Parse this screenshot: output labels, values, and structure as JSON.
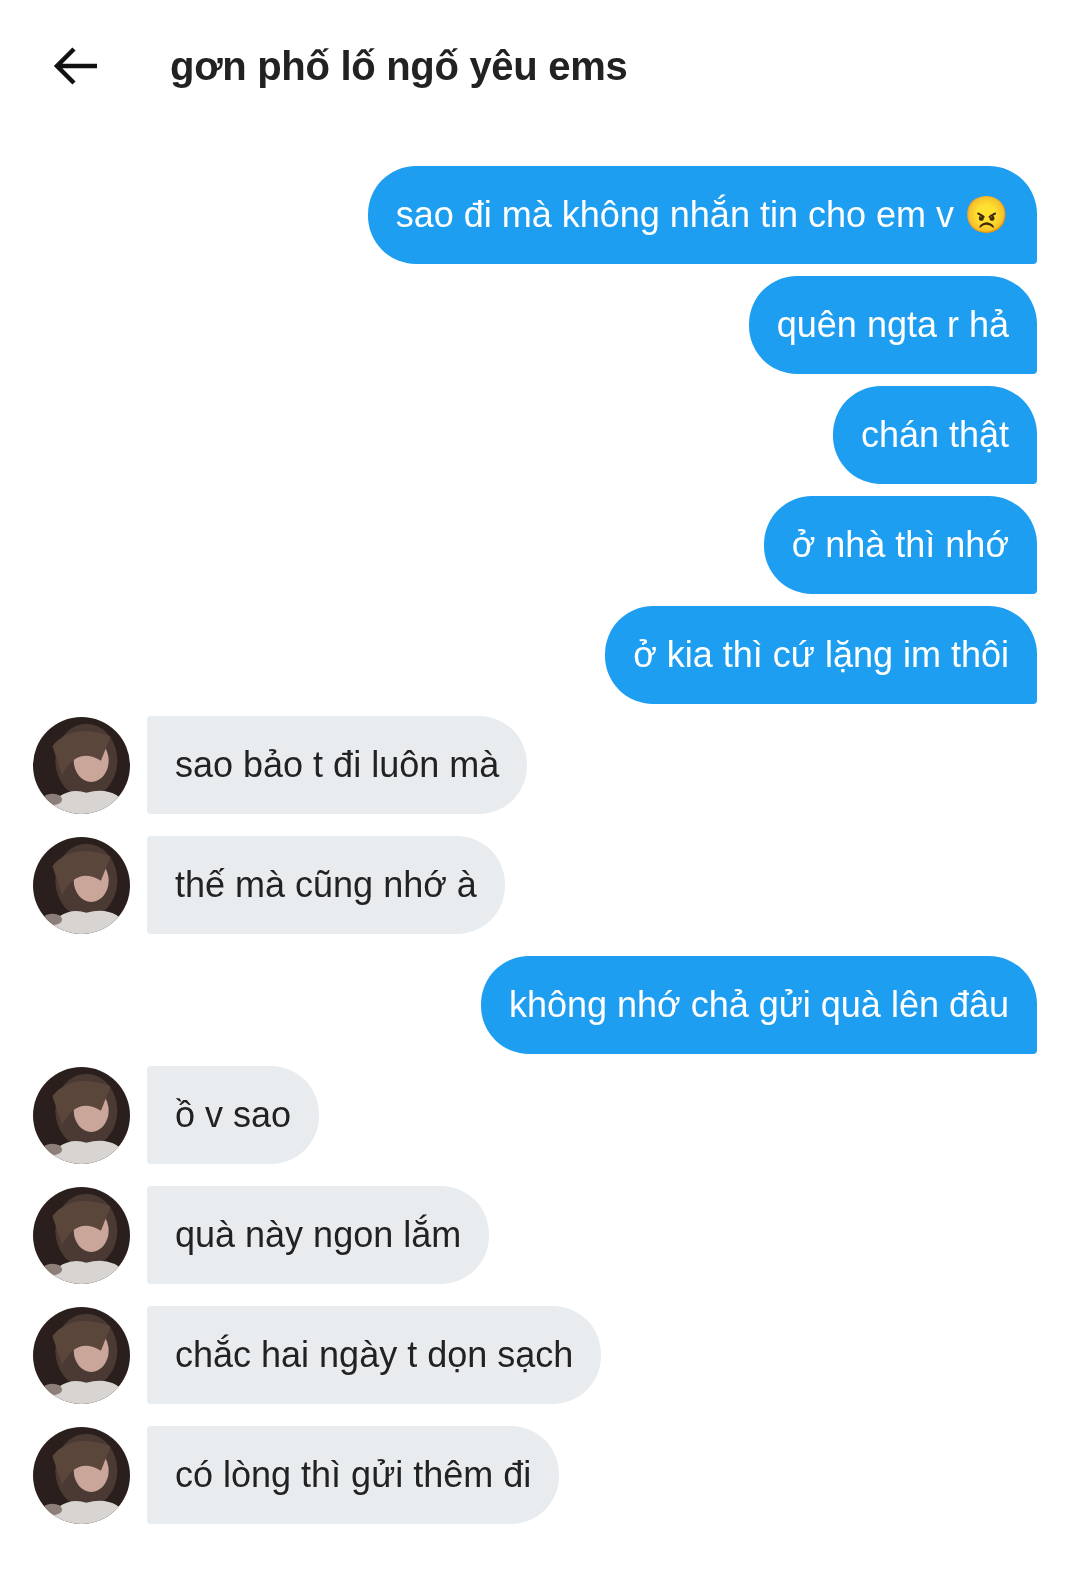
{
  "header": {
    "title": "gơn phố lố ngố yêu ems"
  },
  "messages": [
    {
      "kind": "sent",
      "text": "sao đi mà không nhắn tin cho em v 😠"
    },
    {
      "kind": "sent",
      "text": "quên ngta r hả"
    },
    {
      "kind": "sent",
      "text": "chán thật"
    },
    {
      "kind": "sent",
      "text": "ở nhà thì nhớ"
    },
    {
      "kind": "sent",
      "text": "ở kia thì cứ lặng im thôi"
    },
    {
      "kind": "received",
      "text": "sao bảo t đi luôn mà"
    },
    {
      "kind": "received",
      "text": "thế mà cũng nhớ à"
    },
    {
      "kind": "sent",
      "text": "không nhớ chả gửi quà lên đâu"
    },
    {
      "kind": "received",
      "text": "ồ v sao"
    },
    {
      "kind": "received",
      "text": "quà này ngon lắm"
    },
    {
      "kind": "received",
      "text": "chắc hai ngày t dọn sạch"
    },
    {
      "kind": "received",
      "text": "có lòng thì gửi thêm đi"
    }
  ]
}
